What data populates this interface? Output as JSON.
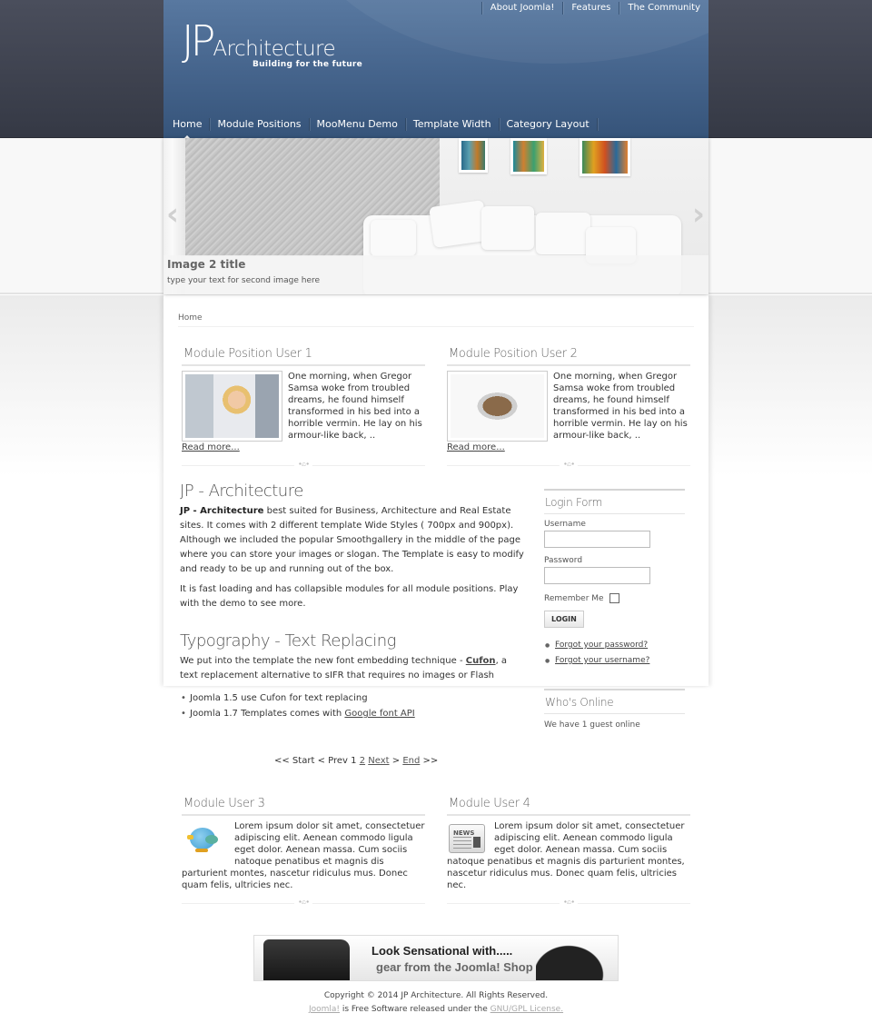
{
  "header": {
    "logo_main": "JP",
    "logo_sub": "Architecture",
    "tagline": "Building for the future",
    "top_menu": [
      "About Joomla!",
      "Features",
      "The Community"
    ],
    "main_menu": [
      "Home",
      "Module Positions",
      "MooMenu Demo",
      "Template Width",
      "Category Layout"
    ],
    "active_menu": "Home"
  },
  "slideshow": {
    "title": "Image 2 title",
    "text": "type your text for second image here",
    "prev_arrow": "‹",
    "next_arrow": "›"
  },
  "breadcrumb": "Home",
  "top_modules": [
    {
      "title": "Module Position User 1",
      "image": "support-agent-photo",
      "text": "One morning, when Gregor Samsa woke from troubled dreams, he found himself transformed in his bed into a horrible vermin. He lay on his armour-like back, ..",
      "read_more": "Read more..."
    },
    {
      "title": "Module Position User 2",
      "image": "house-blueprint-photo",
      "text": "One morning, when Gregor Samsa woke from troubled dreams, he found himself transformed in his bed into a horrible vermin. He lay on his armour-like back, ..",
      "read_more": "Read more..."
    }
  ],
  "article": {
    "title": "JP - Architecture",
    "intro_bold": "JP - Architecture",
    "intro_rest": " best suited for Business, Architecture and Real Estate sites. It comes with 2 different template Wide Styles ( 700px and 900px).",
    "para2": "Although we included the popular Smoothgallery in the middle of the page where you can store your images or slogan. The Template is easy to modify and ready to be up and running out of the box.",
    "para3": "It is fast loading and has collapsible modules for all module positions. Play with the demo to see more.",
    "typo_title": "Typography - Text Replacing",
    "typo_text_before": "We put into the template the new font embedding technique - ",
    "typo_link": "Cufon",
    "typo_text_after": ", a text replacement alternative to sIFR that requires no images or Flash",
    "list": [
      {
        "text": "Joomla 1.5 use Cufon for text replacing",
        "link": ""
      },
      {
        "text": "Joomla 1.7 Templates comes with ",
        "link": "Google font API"
      }
    ]
  },
  "pagination": {
    "start": "<< Start",
    "prev": "< Prev",
    "current": "1",
    "page2": "2",
    "next": "Next",
    "next_suffix": ">",
    "end": "End",
    "end_suffix": ">>"
  },
  "login": {
    "title": "Login Form",
    "username_label": "Username",
    "username_value": "",
    "password_label": "Password",
    "password_value": "",
    "remember_label": "Remember Me",
    "remember_checked": false,
    "button": "LOGIN",
    "links": [
      "Forgot your password?",
      "Forgot your username?"
    ]
  },
  "whos_online": {
    "title": "Who's Online",
    "text": "We have 1 guest online"
  },
  "bottom_modules": [
    {
      "title": "Module User 3",
      "icon": "bird-icon",
      "text": "Lorem ipsum dolor sit amet, consectetuer adipiscing elit. Aenean commodo ligula eget dolor. Aenean massa. Cum sociis natoque penatibus et magnis dis parturient montes, nascetur ridiculus mus. Donec quam felis, ultricies nec."
    },
    {
      "title": "Module User 4",
      "icon": "newspaper-icon",
      "text": "Lorem ipsum dolor sit amet, consectetuer adipiscing elit. Aenean commodo ligula eget dolor. Aenean massa. Cum sociis natoque penatibus et magnis dis parturient montes, nascetur ridiculus mus. Donec quam felis, ultricies nec."
    }
  ],
  "banner": {
    "line1": "Look Sensational with.....",
    "line2": "gear from the Joomla! Shop",
    "news_label": "NEWS"
  },
  "footer": {
    "copyright": "Copyright © 2014 JP Architecture. All Rights Reserved.",
    "license_link1": "Joomla!",
    "license_text": " is Free Software released under the ",
    "license_link2": "GNU/GPL License."
  },
  "divider_glyph": "∙ಎ∙"
}
